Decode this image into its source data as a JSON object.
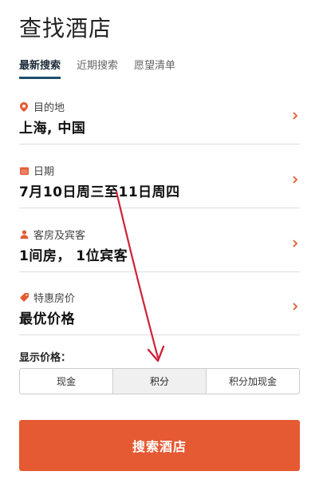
{
  "page": {
    "title": "查找酒店"
  },
  "tabs": [
    {
      "label": "最新搜索",
      "active": true
    },
    {
      "label": "近期搜索",
      "active": false
    },
    {
      "label": "愿望清单",
      "active": false
    }
  ],
  "fields": {
    "destination": {
      "label": "目的地",
      "value": "上海, 中国",
      "icon": "location-pin-icon"
    },
    "dates": {
      "label": "日期",
      "value": "7月10日周三至11日周四",
      "icon": "calendar-icon"
    },
    "guests": {
      "label": "客房及宾客",
      "value": "1间房， 1位宾客",
      "icon": "person-icon"
    },
    "rate": {
      "label": "特惠房价",
      "value": "最优价格",
      "icon": "tag-icon"
    }
  },
  "price_display": {
    "label": "显示价格：",
    "options": [
      "现金",
      "积分",
      "积分加现金"
    ],
    "selected": "积分"
  },
  "search_button": {
    "label": "搜索酒店"
  },
  "colors": {
    "accent": "#e55a33",
    "tab_underline": "#1f4e6e",
    "annotation_arrow": "#d0213a"
  }
}
